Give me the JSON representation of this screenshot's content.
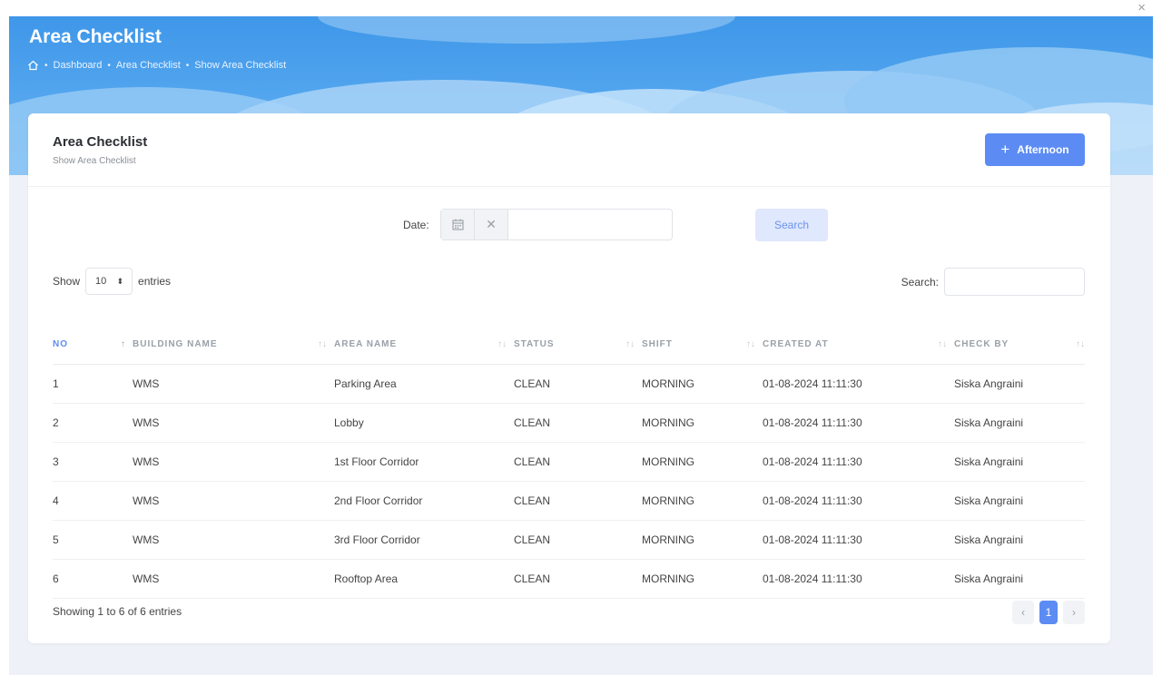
{
  "window": {
    "close_glyph": "×"
  },
  "header": {
    "title": "Area Checklist",
    "breadcrumb": [
      "Dashboard",
      "Area Checklist",
      "Show Area Checklist"
    ],
    "home_icon": "home-icon"
  },
  "card": {
    "title": "Area Checklist",
    "subtitle": "Show Area Checklist",
    "add_button": {
      "icon": "plus-icon",
      "label": "Afternoon"
    }
  },
  "filter": {
    "date_label": "Date:",
    "date_value": "",
    "calendar_icon": "calendar-icon",
    "clear_icon": "close-icon",
    "search_button": "Search"
  },
  "table_controls": {
    "show_label": "Show",
    "entries_value": "10",
    "entries_label": "entries",
    "search_label": "Search:",
    "search_value": ""
  },
  "table": {
    "columns": [
      "NO",
      "BUILDING NAME",
      "AREA NAME",
      "STATUS",
      "SHIFT",
      "CREATED AT",
      "CHECK BY"
    ],
    "rows": [
      [
        "1",
        "WMS",
        "Parking Area",
        "CLEAN",
        "MORNING",
        "01-08-2024 11:11:30",
        "Siska Angraini"
      ],
      [
        "2",
        "WMS",
        "Lobby",
        "CLEAN",
        "MORNING",
        "01-08-2024 11:11:30",
        "Siska Angraini"
      ],
      [
        "3",
        "WMS",
        "1st Floor Corridor",
        "CLEAN",
        "MORNING",
        "01-08-2024 11:11:30",
        "Siska Angraini"
      ],
      [
        "4",
        "WMS",
        "2nd Floor Corridor",
        "CLEAN",
        "MORNING",
        "01-08-2024 11:11:30",
        "Siska Angraini"
      ],
      [
        "5",
        "WMS",
        "3rd Floor Corridor",
        "CLEAN",
        "MORNING",
        "01-08-2024 11:11:30",
        "Siska Angraini"
      ],
      [
        "6",
        "WMS",
        "Rooftop Area",
        "CLEAN",
        "MORNING",
        "01-08-2024 11:11:30",
        "Siska Angraini"
      ]
    ]
  },
  "footer": {
    "info": "Showing 1 to 6 of 6 entries",
    "prev": "‹",
    "page": "1",
    "next": "›"
  },
  "colors": {
    "accent": "#5c8cf3",
    "hero_blue": "#3f97e9"
  }
}
